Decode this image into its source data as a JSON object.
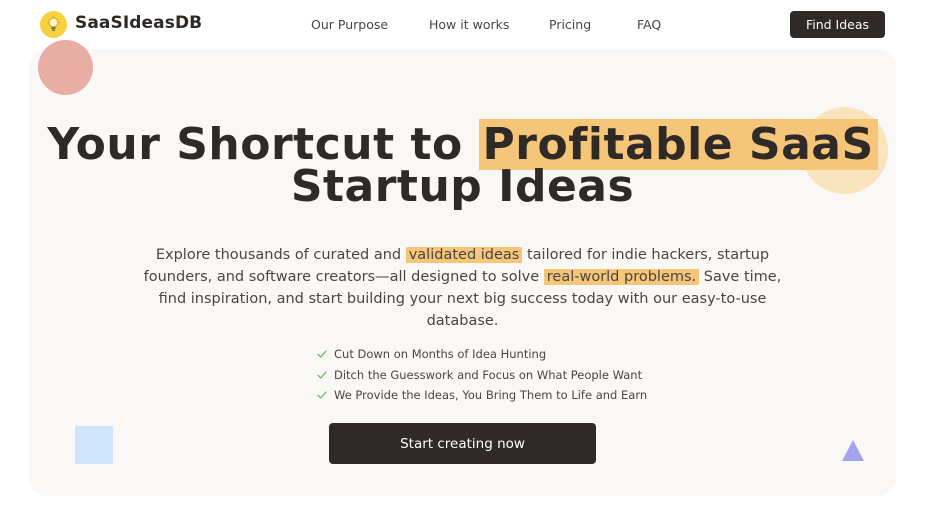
{
  "header": {
    "brand": "SaaSIdeasDB",
    "logo_icon": "lightbulb-icon",
    "nav": [
      "Our Purpose",
      "How it works",
      "Pricing",
      "FAQ"
    ],
    "cta_label": "Find Ideas"
  },
  "hero": {
    "headline_part1": "Your Shortcut to ",
    "headline_highlight": "Profitable SaaS",
    "headline_line2": "Startup Ideas",
    "subtext": {
      "part1": "Explore thousands of curated and ",
      "mark1": "validated ideas",
      "part2": " tailored for indie hackers, startup founders, and software creators—all designed to solve ",
      "mark2": "real-world problems.",
      "part3": " Save time, find inspiration, and start building your next big success today with our easy-to-use database."
    },
    "features": [
      "Cut Down on Months of Idea Hunting",
      "Ditch the Guesswork and Focus on What People Want",
      "We Provide the Ideas, You Bring Them to Life and Earn"
    ],
    "feature_icon": "check-icon",
    "cta_label": "Start creating now"
  },
  "colors": {
    "dark": "#2f2a27",
    "highlight": "#f5c679",
    "background_card": "#faf8f6",
    "check": "#5cb85c",
    "deco_red": "#e8ada3",
    "deco_yellow": "#f9e4bd",
    "deco_blue": "#cfe5fb",
    "deco_purple": "#a4a4ee"
  }
}
